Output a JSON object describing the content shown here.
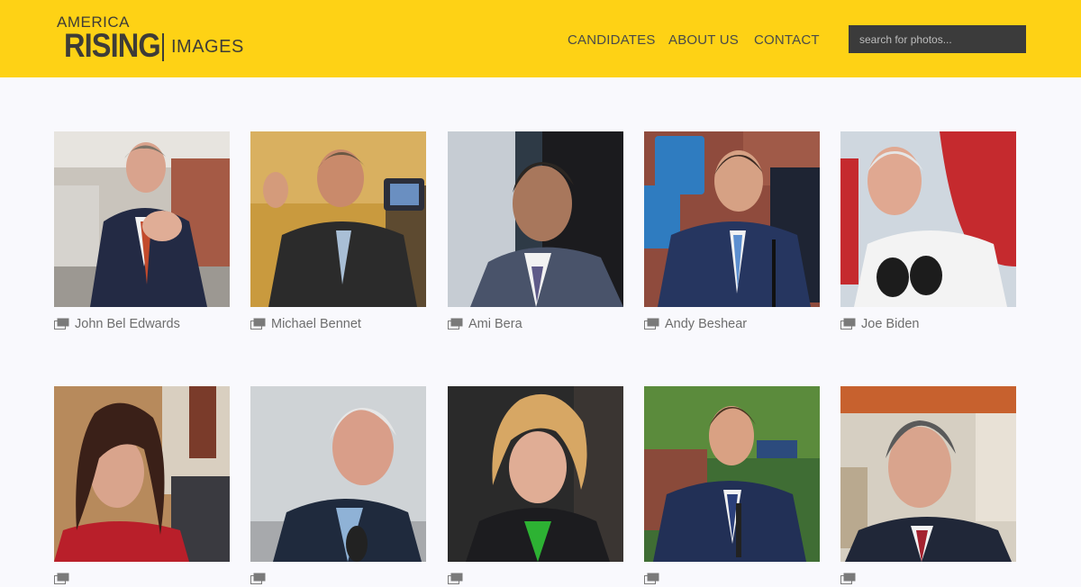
{
  "brand": {
    "line1": "AMERICA",
    "line2": "RISING",
    "line3": "IMAGES"
  },
  "nav": {
    "items": [
      "CANDIDATES",
      "ABOUT US",
      "CONTACT"
    ]
  },
  "search": {
    "placeholder": "search for photos..."
  },
  "gallery": {
    "items": [
      {
        "name": "John Bel Edwards"
      },
      {
        "name": "Michael Bennet"
      },
      {
        "name": "Ami Bera"
      },
      {
        "name": "Andy Beshear"
      },
      {
        "name": "Joe Biden"
      },
      {
        "name": ""
      },
      {
        "name": ""
      },
      {
        "name": ""
      },
      {
        "name": ""
      },
      {
        "name": ""
      }
    ]
  },
  "colors": {
    "header_bg": "#fed215",
    "page_bg": "#f9f9fd",
    "nav_text": "#4a4a48",
    "caption_text": "#6d6d6d",
    "search_bg": "#3b3b3b"
  },
  "icons": {
    "caption_icon": "gallery-icon"
  }
}
